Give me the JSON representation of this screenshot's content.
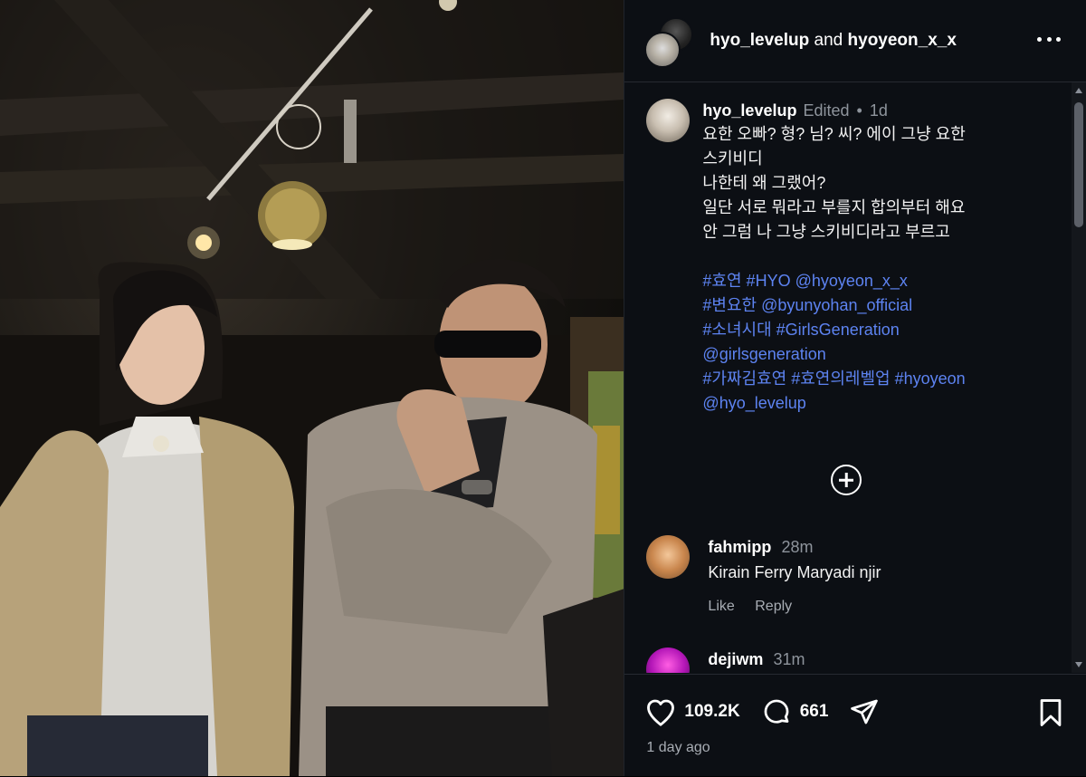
{
  "header": {
    "user1": "hyo_levelup",
    "and_text": "and",
    "user2": "hyoyeon_x_x"
  },
  "caption": {
    "username": "hyo_levelup",
    "edited": "Edited",
    "separator": "•",
    "time": "1d",
    "lines": [
      "요한 오빠? 형? 님? 씨? 에이 그냥 요한",
      "스키비디",
      "나한테 왜 그랬어?",
      "일단 서로 뭐라고 부를지 합의부터 해요",
      "안 그럼 나 그냥 스키비디라고 부르고"
    ],
    "tags": [
      "#효연 #HYO @hyoyeon_x_x",
      "#변요한 @byunyohan_official",
      "#소녀시대 #GirlsGeneration",
      "@girlsgeneration",
      "#가짜김효연 #효연의레벨업 #hyoyeon",
      "@hyo_levelup"
    ]
  },
  "comments": [
    {
      "username": "fahmipp",
      "time": "28m",
      "text": "Kirain Ferry Maryadi njir",
      "like": "Like",
      "reply": "Reply"
    },
    {
      "username": "dejiwm",
      "time": "31m"
    }
  ],
  "footer": {
    "likes": "109.2K",
    "comments": "661",
    "posted": "1 day ago"
  },
  "icons": {
    "more": "more-horizontal-icon",
    "load_more": "plus-circle-icon",
    "like": "heart-icon",
    "comment": "comment-bubble-icon",
    "share": "send-icon",
    "save": "bookmark-icon"
  },
  "colors": {
    "panel_bg": "#0c0f14",
    "link": "#5d83f1",
    "muted": "#8e949c"
  }
}
